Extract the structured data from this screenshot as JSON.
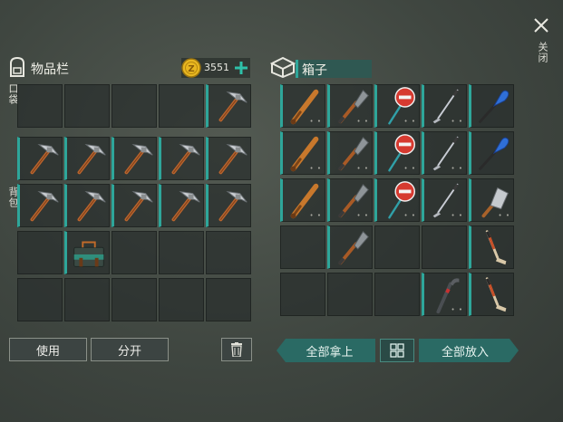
{
  "close": {
    "label": "关闭"
  },
  "inventory": {
    "title": "物品栏",
    "coins": "3551",
    "pocket_label": "口袋",
    "backpack_label": "背包",
    "rows": [
      [
        "empty",
        "empty",
        "empty",
        "empty",
        "pickaxe"
      ],
      [
        "pickaxe",
        "pickaxe",
        "pickaxe",
        "pickaxe",
        "pickaxe"
      ],
      [
        "pickaxe",
        "pickaxe",
        "pickaxe",
        "pickaxe",
        "pickaxe"
      ],
      [
        "empty",
        "toolbox",
        "empty",
        "empty",
        "empty"
      ],
      [
        "empty",
        "empty",
        "empty",
        "empty",
        "empty"
      ]
    ],
    "use_label": "使用",
    "split_label": "分开"
  },
  "box": {
    "title": "箱子",
    "rows": [
      [
        "bat",
        "shovel",
        "stop-sign",
        "golf-club",
        "paddle"
      ],
      [
        "bat",
        "shovel",
        "stop-sign",
        "golf-club",
        "paddle"
      ],
      [
        "bat",
        "shovel",
        "stop-sign",
        "golf-club",
        "cleaver"
      ],
      [
        "empty",
        "shovel",
        "empty",
        "empty",
        "hockey-stick"
      ],
      [
        "empty",
        "empty",
        "empty",
        "crowbar",
        "hockey-stick"
      ]
    ],
    "take_all_label": "全部拿上",
    "put_all_label": "全部放入"
  },
  "colors": {
    "accent": "#2ea69a",
    "coin": "#e8b620",
    "plus": "#2ec0a8"
  }
}
